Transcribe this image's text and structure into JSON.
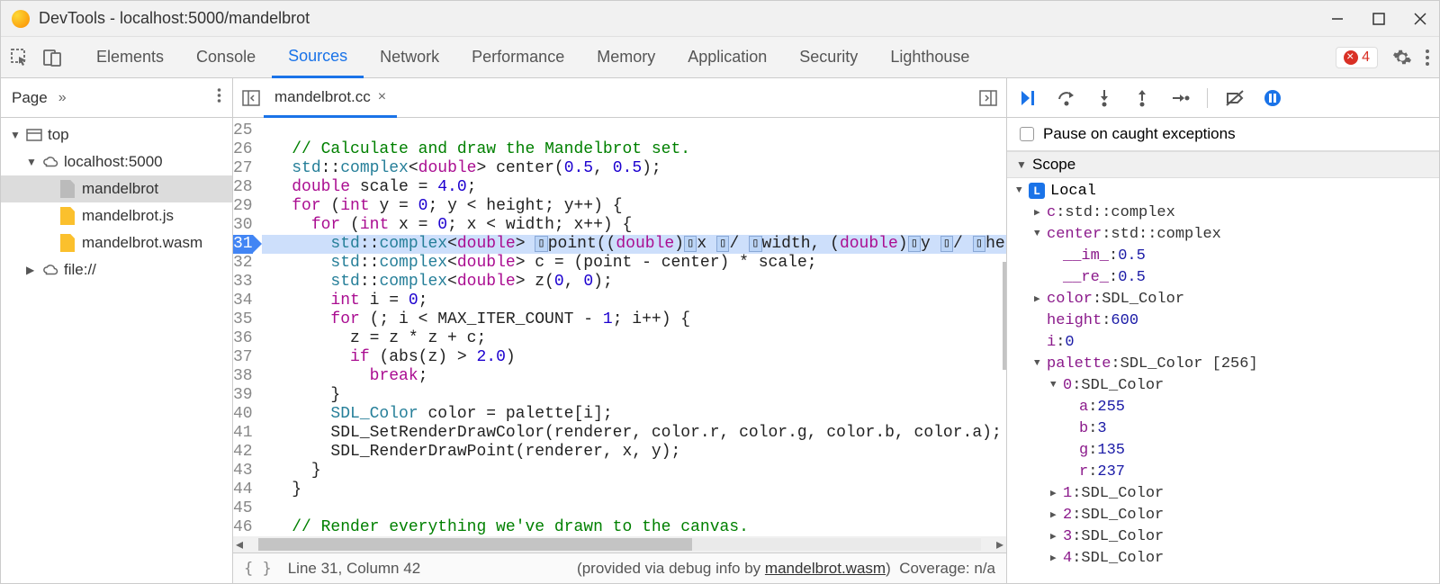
{
  "window": {
    "title": "DevTools - localhost:5000/mandelbrot"
  },
  "tabs": {
    "items": [
      "Elements",
      "Console",
      "Sources",
      "Network",
      "Performance",
      "Memory",
      "Application",
      "Security",
      "Lighthouse"
    ],
    "active": "Sources",
    "errorCount": "4"
  },
  "sidebar": {
    "title": "Page",
    "tree": {
      "top": "top",
      "host": "localhost:5000",
      "files": [
        "mandelbrot",
        "mandelbrot.js",
        "mandelbrot.wasm"
      ],
      "fileScheme": "file://"
    }
  },
  "editor": {
    "fileName": "mandelbrot.cc",
    "highlightedLine": 31,
    "gutterStart": 25,
    "lines": [
      "",
      "  // Calculate and draw the Mandelbrot set.",
      "  std::complex<double> center(0.5, 0.5);",
      "  double scale = 4.0;",
      "  for (int y = 0; y < height; y++) {",
      "    for (int x = 0; x < width; x++) {",
      "      std::complex<double> ▯point((double)▯x ▯/ ▯width, (double)▯y ▯/ ▯hei",
      "      std::complex<double> c = (point - center) * scale;",
      "      std::complex<double> z(0, 0);",
      "      int i = 0;",
      "      for (; i < MAX_ITER_COUNT - 1; i++) {",
      "        z = z * z + c;",
      "        if (abs(z) > 2.0)",
      "          break;",
      "      }",
      "      SDL_Color color = palette[i];",
      "      SDL_SetRenderDrawColor(renderer, color.r, color.g, color.b, color.a);",
      "      SDL_RenderDrawPoint(renderer, x, y);",
      "    }",
      "  }",
      "",
      "  // Render everything we've drawn to the canvas.",
      ""
    ]
  },
  "statusbar": {
    "cursor": "Line 31, Column 42",
    "debugInfoPrefix": "(provided via debug info by ",
    "debugInfoFile": "mandelbrot.wasm",
    "debugInfoSuffix": ")",
    "coverage": "Coverage: n/a"
  },
  "debugger": {
    "pauseLabel": "Pause on caught exceptions",
    "scopeLabel": "Scope",
    "local": {
      "label": "Local",
      "entries": [
        {
          "tri": "▶",
          "key": "c",
          "val": "std::complex<double>",
          "indent": 1
        },
        {
          "tri": "▼",
          "key": "center",
          "val": "std::complex<double>",
          "indent": 1
        },
        {
          "tri": "",
          "key": "__im_",
          "val": "0.5",
          "num": true,
          "indent": 2
        },
        {
          "tri": "",
          "key": "__re_",
          "val": "0.5",
          "num": true,
          "indent": 2
        },
        {
          "tri": "▶",
          "key": "color",
          "val": "SDL_Color",
          "indent": 1
        },
        {
          "tri": "",
          "key": "height",
          "val": "600",
          "num": true,
          "indent": 1
        },
        {
          "tri": "",
          "key": "i",
          "val": "0",
          "num": true,
          "indent": 1
        },
        {
          "tri": "▼",
          "key": "palette",
          "val": "SDL_Color [256]",
          "indent": 1
        },
        {
          "tri": "▼",
          "key": "0",
          "val": "SDL_Color",
          "indent": 2
        },
        {
          "tri": "",
          "key": "a",
          "val": "255",
          "num": true,
          "indent": 3
        },
        {
          "tri": "",
          "key": "b",
          "val": "3",
          "num": true,
          "indent": 3
        },
        {
          "tri": "",
          "key": "g",
          "val": "135",
          "num": true,
          "indent": 3
        },
        {
          "tri": "",
          "key": "r",
          "val": "237",
          "num": true,
          "indent": 3
        },
        {
          "tri": "▶",
          "key": "1",
          "val": "SDL_Color",
          "indent": 2
        },
        {
          "tri": "▶",
          "key": "2",
          "val": "SDL_Color",
          "indent": 2
        },
        {
          "tri": "▶",
          "key": "3",
          "val": "SDL_Color",
          "indent": 2
        },
        {
          "tri": "▶",
          "key": "4",
          "val": "SDL_Color",
          "indent": 2
        }
      ]
    }
  }
}
